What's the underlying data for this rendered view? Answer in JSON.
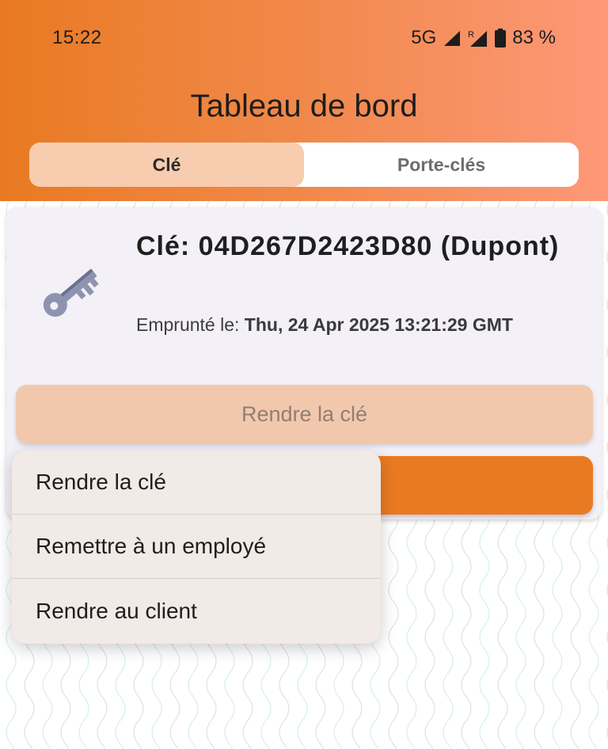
{
  "status_bar": {
    "time": "15:22",
    "network": "5G",
    "roaming": "R",
    "battery": "83 %"
  },
  "header": {
    "title": "Tableau de bord",
    "tabs": [
      {
        "label": "Clé",
        "active": true
      },
      {
        "label": "Porte-clés",
        "active": false
      }
    ]
  },
  "key_card": {
    "icon": "key-icon",
    "title": "Clé: 04D267D2423D80 (Dupont)",
    "borrowed_label": "Emprunté le:",
    "borrowed_date": "Thu, 24 Apr 2025 13:21:29 GMT",
    "return_button_label": "Rendre la clé"
  },
  "context_menu": {
    "items": [
      {
        "label": "Rendre la clé"
      },
      {
        "label": "Remettre à un employé"
      },
      {
        "label": "Rendre au client"
      }
    ]
  },
  "colors": {
    "accent": "#e97a22",
    "header_gradient_end": "#fd9878",
    "tab_active": "#f7ccaf",
    "card_bg": "#f3f0f7",
    "menu_bg": "#f1eae6"
  }
}
